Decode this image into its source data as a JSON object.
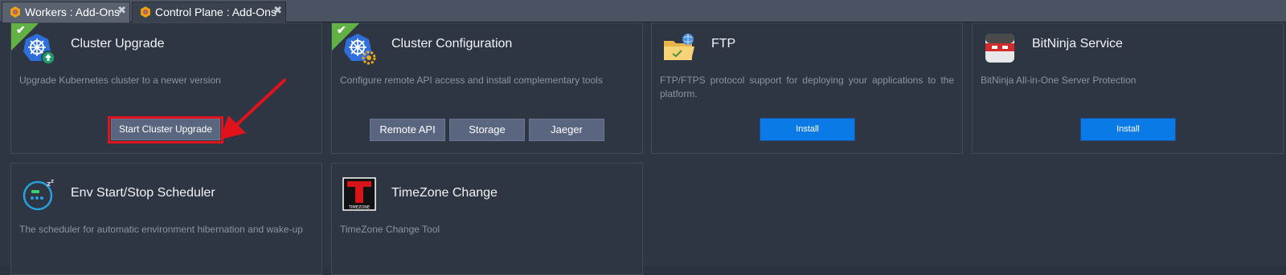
{
  "tabs": [
    {
      "label": "Workers : Add-Ons",
      "icon": "addon-hexagon-icon",
      "active": false,
      "close": "✖"
    },
    {
      "label": "Control Plane : Add-Ons",
      "icon": "addon-hexagon-icon",
      "active": true,
      "close": "✖"
    }
  ],
  "cards": {
    "cluster_upgrade": {
      "title": "Cluster Upgrade",
      "description": "Upgrade Kubernetes cluster to a newer version",
      "installed": true,
      "icon": "kubernetes-upgrade-icon",
      "button": "Start Cluster Upgrade"
    },
    "cluster_configuration": {
      "title": "Cluster Configuration",
      "description": "Configure remote API access and install complementary tools",
      "installed": true,
      "icon": "kubernetes-config-icon",
      "buttons": {
        "remote_api": "Remote API",
        "storage": "Storage",
        "jaeger": "Jaeger"
      }
    },
    "ftp": {
      "title": "FTP",
      "description": "FTP/FTPS protocol support for deploying your applications to the platform.",
      "icon": "ftp-folder-icon",
      "button": "Install"
    },
    "bitninja": {
      "title": "BitNinja Service",
      "description": "BitNinja All-in-One Server Protection",
      "icon": "bitninja-icon",
      "button": "Install"
    },
    "scheduler": {
      "title": "Env Start/Stop Scheduler",
      "description": "The scheduler for automatic environment hibernation and wake-up",
      "icon": "scheduler-icon"
    },
    "timezone": {
      "title": "TimeZone Change",
      "description": "TimeZone Change Tool",
      "icon": "timezone-icon",
      "logo_text": "TIMEZONE"
    }
  },
  "colors": {
    "installed_badge": "#62b144",
    "install_button": "#0a7be6",
    "highlight": "#e0121b"
  }
}
